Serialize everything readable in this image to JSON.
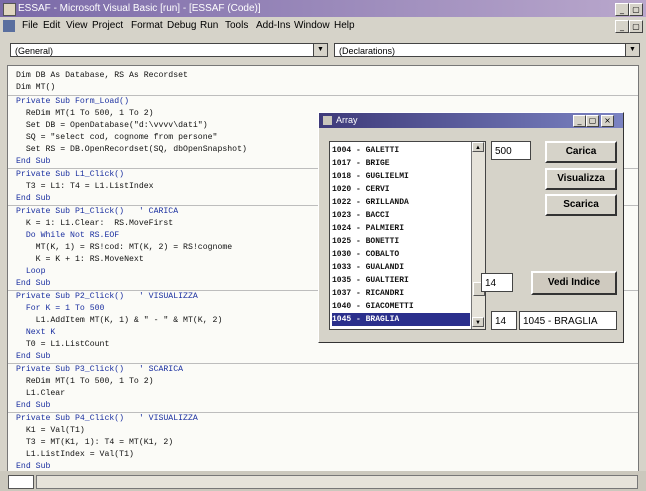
{
  "window": {
    "title": "ESSAF - Microsoft Visual Basic [run] - [ESSAF (Code)]"
  },
  "menu": [
    "File",
    "Edit",
    "View",
    "Project",
    "Format",
    "Debug",
    "Run",
    "Tools",
    "Add-Ins",
    "Window",
    "Help"
  ],
  "combos": {
    "object": "(General)",
    "procedure": "(Declarations)"
  },
  "code": [
    "Dim DB As Database, RS As Recordset",
    "Dim MT()",
    "Private Sub Form_Load()",
    "  ReDim MT(1 To 500, 1 To 2)",
    "  Set DB = OpenDatabase(\"d:\\vvvv\\dati\")",
    "  SQ = \"select cod, cognome from persone\"",
    "  Set RS = DB.OpenRecordset(SQ, dbOpenSnapshot)",
    "End Sub",
    "Private Sub L1_Click()",
    "  T3 = L1: T4 = L1.ListIndex",
    "End Sub",
    "Private Sub P1_Click()   ' CARICA",
    "  K = 1: L1.Clear:  RS.MoveFirst",
    "  Do While Not RS.EOF",
    "    MT(K, 1) = RS!cod: MT(K, 2) = RS!cognome",
    "    K = K + 1: RS.MoveNext",
    "  Loop",
    "End Sub",
    "Private Sub P2_Click()   ' VISUALIZZA",
    "  For K = 1 To 500",
    "    L1.AddItem MT(K, 1) & \" - \" & MT(K, 2)",
    "  Next K",
    "  T0 = L1.ListCount",
    "End Sub",
    "Private Sub P3_Click()   ' SCARICA",
    "  ReDim MT(1 To 500, 1 To 2)",
    "  L1.Clear",
    "End Sub",
    "Private Sub P4_Click()   ' VISUALIZZA",
    "  K1 = Val(T1)",
    "  T3 = MT(K1, 1): T4 = MT(K1, 2)",
    "  L1.ListIndex = Val(T1)",
    "End Sub"
  ],
  "dialog": {
    "title": "Array",
    "list": [
      "1004 - GALETTI",
      "1017 - BRIGE",
      "1018 - GUGLIELMI",
      "1020 - CERVI",
      "1022 - GRILLANDA",
      "1023 - BACCI",
      "1024 - PALMIERI",
      "1025 - BONETTI",
      "1030 - COBALTO",
      "1033 - GUALANDI",
      "1035 - GUALTIERI",
      "1037 - RICANDRI",
      "1040 - GIACOMETTI",
      "1045 - BRAGLIA"
    ],
    "selected_item": "1045 - BRAGLIA",
    "count_value": "500",
    "buttons": {
      "carica": "Carica",
      "visualizza": "Visualizza",
      "scarica": "Scarica",
      "vedi_indice": "Vedi Indice"
    },
    "index_input": "14",
    "result_index": "14",
    "result_value": "1045 - BRAGLIA"
  }
}
